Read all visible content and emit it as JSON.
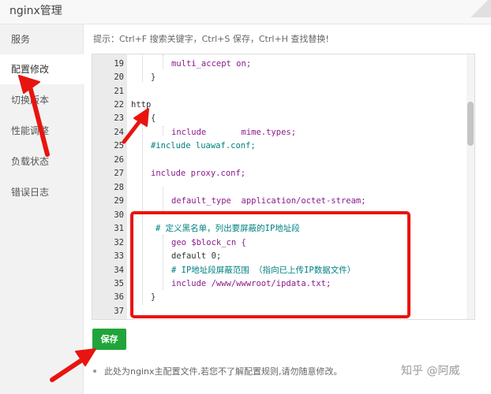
{
  "window": {
    "title": "nginx管理"
  },
  "sidebar": {
    "items": [
      {
        "label": "服务"
      },
      {
        "label": "配置修改"
      },
      {
        "label": "切换版本"
      },
      {
        "label": "性能调整"
      },
      {
        "label": "负载状态"
      },
      {
        "label": "错误日志"
      }
    ],
    "active": "配置修改"
  },
  "hint": "提示：Ctrl+F 搜索关键字，Ctrl+S 保存，Ctrl+H 查找替换!",
  "editor": {
    "lines": [
      {
        "n": "19",
        "code": "multi_accept on;"
      },
      {
        "n": "20",
        "code": "}"
      },
      {
        "n": "21",
        "code": ""
      },
      {
        "n": "22",
        "code": "http"
      },
      {
        "n": "23",
        "code": "{"
      },
      {
        "n": "24",
        "code": "include       mime.types;"
      },
      {
        "n": "25",
        "code": "#include luawaf.conf;"
      },
      {
        "n": "26",
        "code": ""
      },
      {
        "n": "27",
        "code": "include proxy.conf;"
      },
      {
        "n": "28",
        "code": ""
      },
      {
        "n": "29",
        "code": "default_type  application/octet-stream;"
      },
      {
        "n": "30",
        "code": ""
      },
      {
        "n": "31",
        "code": "# 定义黑名单，列出要屏蔽的IP地址段"
      },
      {
        "n": "32",
        "code": "geo $block_cn {"
      },
      {
        "n": "33",
        "code": "default 0;"
      },
      {
        "n": "34",
        "code": "# IP地址段屏蔽范围 （指向已上传IP数据文件）"
      },
      {
        "n": "35",
        "code": "include /www/wwwroot/ipdata.txt;"
      },
      {
        "n": "36",
        "code": "}"
      },
      {
        "n": "37",
        "code": ""
      }
    ]
  },
  "actions": {
    "save_label": "保存"
  },
  "note": "此处为nginx主配置文件,若您不了解配置规则,请勿随意修改。",
  "watermark": "知乎 @阿威",
  "colors": {
    "save": "#20a53a",
    "annotation": "#e8140f"
  }
}
